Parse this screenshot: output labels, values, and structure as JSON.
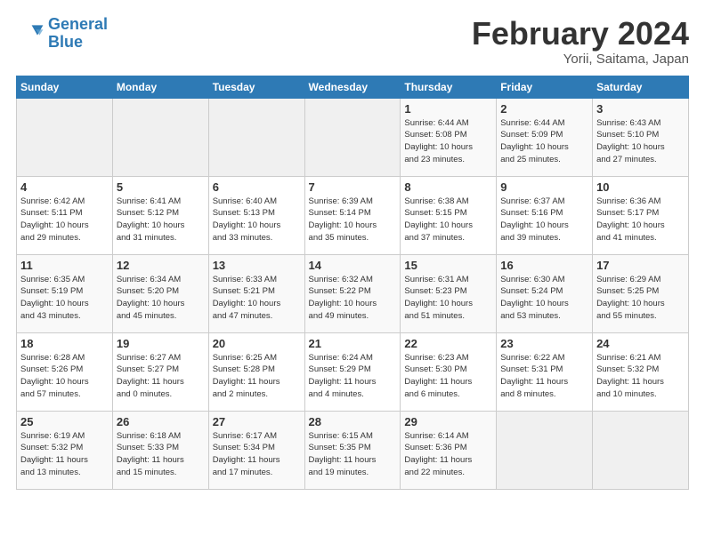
{
  "logo": {
    "line1": "General",
    "line2": "Blue"
  },
  "title": "February 2024",
  "subtitle": "Yorii, Saitama, Japan",
  "weekdays": [
    "Sunday",
    "Monday",
    "Tuesday",
    "Wednesday",
    "Thursday",
    "Friday",
    "Saturday"
  ],
  "weeks": [
    [
      {
        "day": "",
        "info": ""
      },
      {
        "day": "",
        "info": ""
      },
      {
        "day": "",
        "info": ""
      },
      {
        "day": "",
        "info": ""
      },
      {
        "day": "1",
        "info": "Sunrise: 6:44 AM\nSunset: 5:08 PM\nDaylight: 10 hours\nand 23 minutes."
      },
      {
        "day": "2",
        "info": "Sunrise: 6:44 AM\nSunset: 5:09 PM\nDaylight: 10 hours\nand 25 minutes."
      },
      {
        "day": "3",
        "info": "Sunrise: 6:43 AM\nSunset: 5:10 PM\nDaylight: 10 hours\nand 27 minutes."
      }
    ],
    [
      {
        "day": "4",
        "info": "Sunrise: 6:42 AM\nSunset: 5:11 PM\nDaylight: 10 hours\nand 29 minutes."
      },
      {
        "day": "5",
        "info": "Sunrise: 6:41 AM\nSunset: 5:12 PM\nDaylight: 10 hours\nand 31 minutes."
      },
      {
        "day": "6",
        "info": "Sunrise: 6:40 AM\nSunset: 5:13 PM\nDaylight: 10 hours\nand 33 minutes."
      },
      {
        "day": "7",
        "info": "Sunrise: 6:39 AM\nSunset: 5:14 PM\nDaylight: 10 hours\nand 35 minutes."
      },
      {
        "day": "8",
        "info": "Sunrise: 6:38 AM\nSunset: 5:15 PM\nDaylight: 10 hours\nand 37 minutes."
      },
      {
        "day": "9",
        "info": "Sunrise: 6:37 AM\nSunset: 5:16 PM\nDaylight: 10 hours\nand 39 minutes."
      },
      {
        "day": "10",
        "info": "Sunrise: 6:36 AM\nSunset: 5:17 PM\nDaylight: 10 hours\nand 41 minutes."
      }
    ],
    [
      {
        "day": "11",
        "info": "Sunrise: 6:35 AM\nSunset: 5:19 PM\nDaylight: 10 hours\nand 43 minutes."
      },
      {
        "day": "12",
        "info": "Sunrise: 6:34 AM\nSunset: 5:20 PM\nDaylight: 10 hours\nand 45 minutes."
      },
      {
        "day": "13",
        "info": "Sunrise: 6:33 AM\nSunset: 5:21 PM\nDaylight: 10 hours\nand 47 minutes."
      },
      {
        "day": "14",
        "info": "Sunrise: 6:32 AM\nSunset: 5:22 PM\nDaylight: 10 hours\nand 49 minutes."
      },
      {
        "day": "15",
        "info": "Sunrise: 6:31 AM\nSunset: 5:23 PM\nDaylight: 10 hours\nand 51 minutes."
      },
      {
        "day": "16",
        "info": "Sunrise: 6:30 AM\nSunset: 5:24 PM\nDaylight: 10 hours\nand 53 minutes."
      },
      {
        "day": "17",
        "info": "Sunrise: 6:29 AM\nSunset: 5:25 PM\nDaylight: 10 hours\nand 55 minutes."
      }
    ],
    [
      {
        "day": "18",
        "info": "Sunrise: 6:28 AM\nSunset: 5:26 PM\nDaylight: 10 hours\nand 57 minutes."
      },
      {
        "day": "19",
        "info": "Sunrise: 6:27 AM\nSunset: 5:27 PM\nDaylight: 11 hours\nand 0 minutes."
      },
      {
        "day": "20",
        "info": "Sunrise: 6:25 AM\nSunset: 5:28 PM\nDaylight: 11 hours\nand 2 minutes."
      },
      {
        "day": "21",
        "info": "Sunrise: 6:24 AM\nSunset: 5:29 PM\nDaylight: 11 hours\nand 4 minutes."
      },
      {
        "day": "22",
        "info": "Sunrise: 6:23 AM\nSunset: 5:30 PM\nDaylight: 11 hours\nand 6 minutes."
      },
      {
        "day": "23",
        "info": "Sunrise: 6:22 AM\nSunset: 5:31 PM\nDaylight: 11 hours\nand 8 minutes."
      },
      {
        "day": "24",
        "info": "Sunrise: 6:21 AM\nSunset: 5:32 PM\nDaylight: 11 hours\nand 10 minutes."
      }
    ],
    [
      {
        "day": "25",
        "info": "Sunrise: 6:19 AM\nSunset: 5:32 PM\nDaylight: 11 hours\nand 13 minutes."
      },
      {
        "day": "26",
        "info": "Sunrise: 6:18 AM\nSunset: 5:33 PM\nDaylight: 11 hours\nand 15 minutes."
      },
      {
        "day": "27",
        "info": "Sunrise: 6:17 AM\nSunset: 5:34 PM\nDaylight: 11 hours\nand 17 minutes."
      },
      {
        "day": "28",
        "info": "Sunrise: 6:15 AM\nSunset: 5:35 PM\nDaylight: 11 hours\nand 19 minutes."
      },
      {
        "day": "29",
        "info": "Sunrise: 6:14 AM\nSunset: 5:36 PM\nDaylight: 11 hours\nand 22 minutes."
      },
      {
        "day": "",
        "info": ""
      },
      {
        "day": "",
        "info": ""
      }
    ]
  ]
}
